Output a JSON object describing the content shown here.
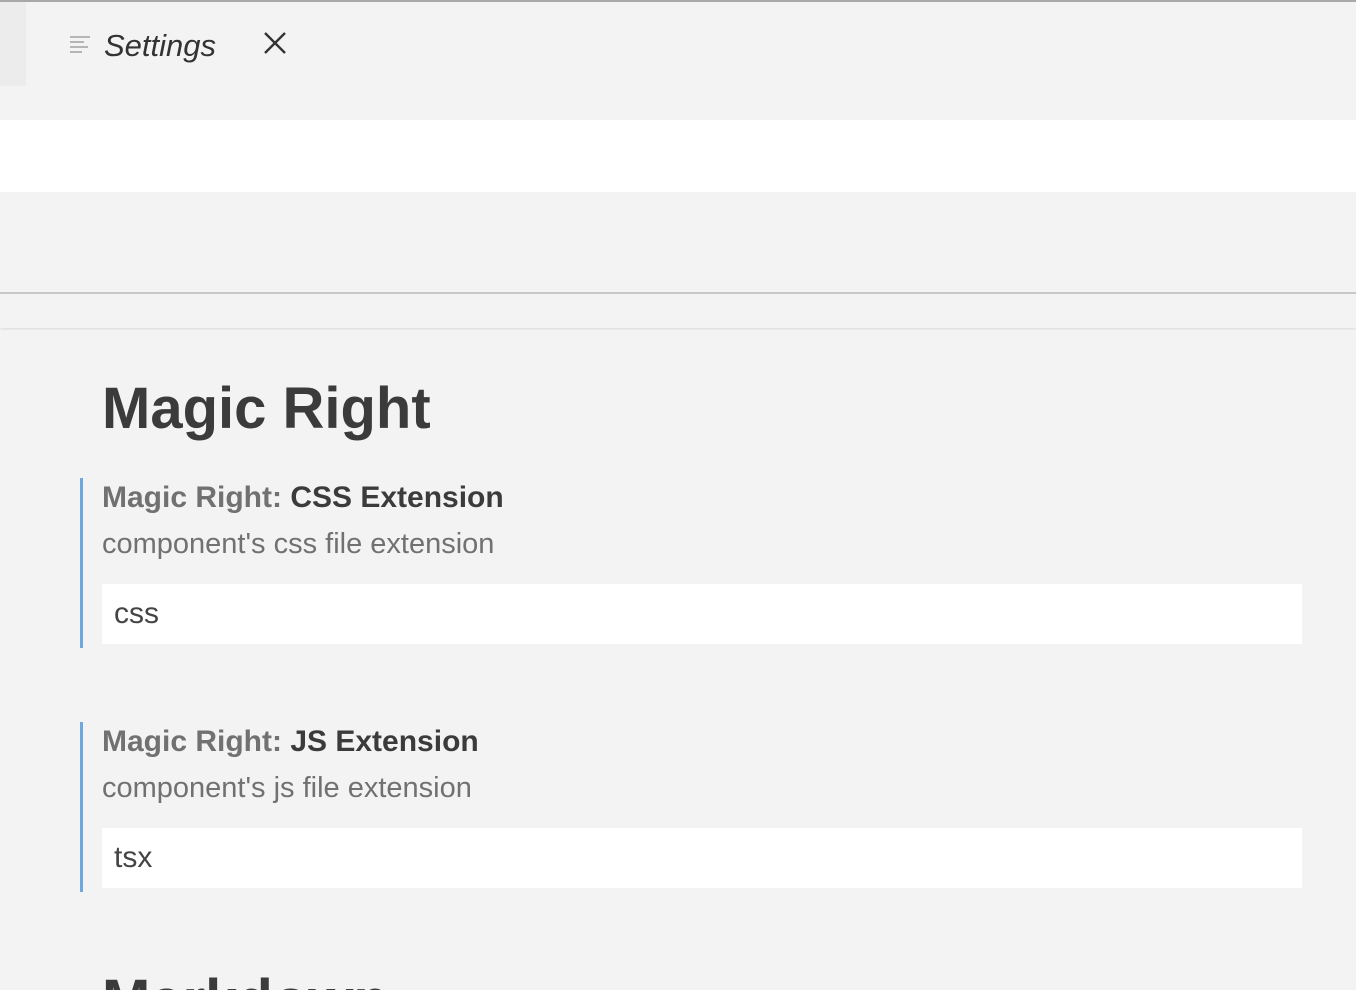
{
  "tab": {
    "title": "Settings",
    "icon": "settings-file-icon",
    "close_icon": "close-icon"
  },
  "search": {
    "value": ""
  },
  "section": {
    "title": "Magic Right"
  },
  "settings": [
    {
      "category": "Magic Right: ",
      "key": "CSS Extension",
      "description": "component's css file extension",
      "value": "css"
    },
    {
      "category": "Magic Right: ",
      "key": "JS Extension",
      "description": "component's js file extension",
      "value": "tsx"
    }
  ],
  "next_section": {
    "title": "Markdown"
  },
  "colors": {
    "accent_border": "#6fa8dc",
    "background": "#f3f3f3",
    "input_background": "#ffffff"
  }
}
